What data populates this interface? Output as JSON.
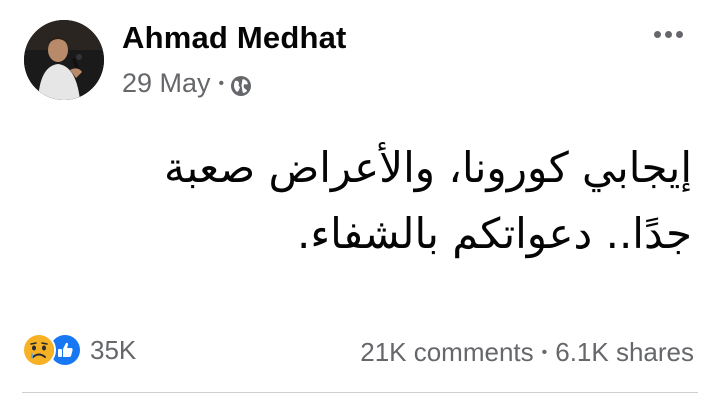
{
  "post": {
    "author": "Ahmad Medhat",
    "date": "29 May",
    "separator": "•",
    "privacy_icon": "globe-icon",
    "more_icon": "more-options-icon",
    "text_lines": [
      "إيجابي كورونا، والأعراض صعبة",
      "جدًا.. دعواتكم بالشفاء."
    ]
  },
  "footer": {
    "reaction_icons": [
      "sad-icon",
      "like-icon"
    ],
    "reactions_count": "35K",
    "comments": "21K comments",
    "separator": "•",
    "shares": "6.1K shares"
  },
  "colors": {
    "text": "#050505",
    "secondary": "#65676b",
    "like_blue": "#1877f2",
    "sad_yellow": "#f7b125",
    "divider": "#ced0d4"
  }
}
